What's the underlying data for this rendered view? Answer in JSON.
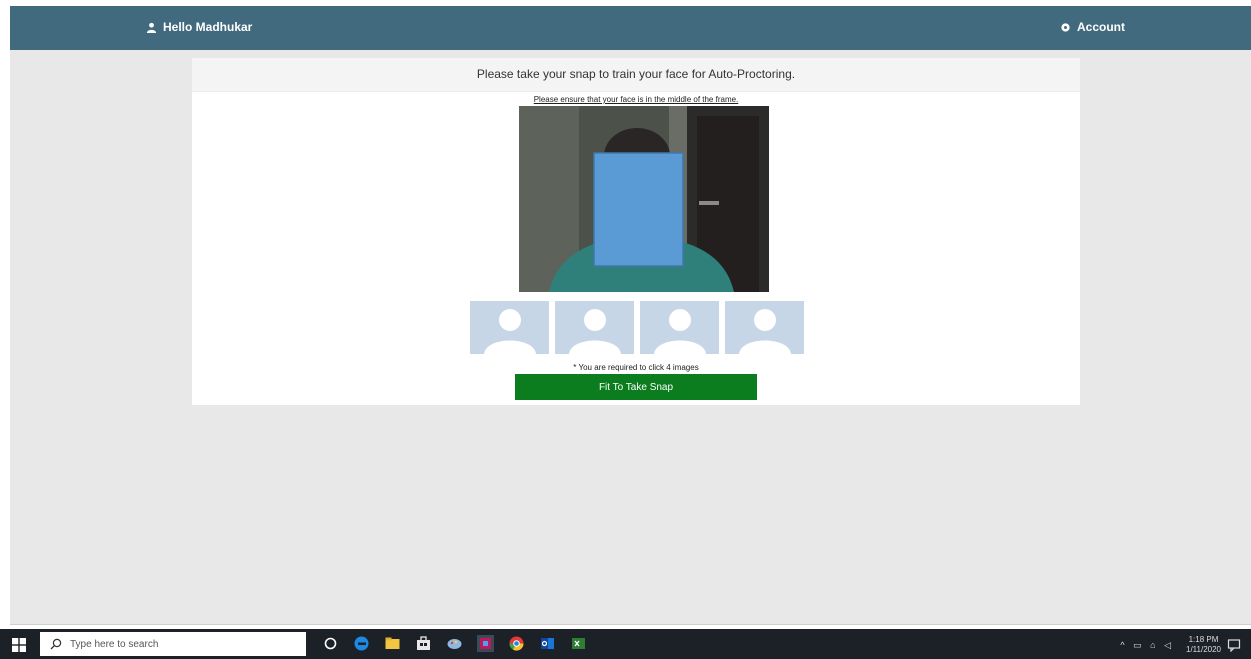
{
  "header": {
    "greeting": "Hello Madhukar",
    "account_label": "Account",
    "bar_color": "#416a7e"
  },
  "panel": {
    "title": "Please take your snap to train your face for Auto-Proctoring.",
    "hint": "Please ensure that your face is in the middle of the frame.",
    "thumbnails": [
      {
        "icon": "user-placeholder-icon"
      },
      {
        "icon": "user-placeholder-icon"
      },
      {
        "icon": "user-placeholder-icon"
      },
      {
        "icon": "user-placeholder-icon"
      }
    ],
    "required_note": "* You are required to click 4 images",
    "snap_button": "Fit To Take Snap",
    "button_color": "#0b7d1e"
  },
  "taskbar": {
    "search_placeholder": "Type here to search",
    "pinned_apps": [
      "cortana-icon",
      "edge-icon",
      "file-explorer-icon",
      "store-icon",
      "paint-icon",
      "app-icon",
      "chrome-icon",
      "outlook-icon",
      "excel-icon"
    ],
    "clock_time": "1:18 PM",
    "clock_date": "1/11/2020"
  }
}
